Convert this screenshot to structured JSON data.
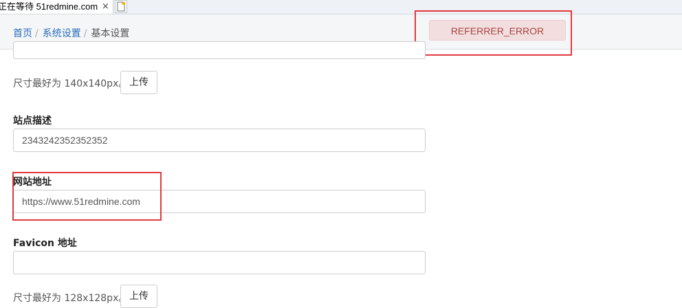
{
  "browser": {
    "tab_title": "正在等待 51redmine.com",
    "tab_close": "×"
  },
  "breadcrumb": {
    "home": "首页",
    "system": "系统设置",
    "current": "基本设置",
    "separator": "/"
  },
  "alert": {
    "message": "REFERRER_ERROR",
    "color": "#a94442",
    "background": "#f2dede"
  },
  "logo_upload": {
    "hint": "尺寸最好为 140x140px。",
    "button": "上传"
  },
  "site_description": {
    "label": "站点描述",
    "value": "2343242352352352"
  },
  "site_url": {
    "label": "网站地址",
    "value": "https://www.51redmine.com"
  },
  "favicon": {
    "label": "Favicon 地址",
    "value": "",
    "hint": "尺寸最好为 128x128px。",
    "button": "上传"
  },
  "highlight_color": "#e0393e",
  "icons": {
    "newtab": "new-tab-icon",
    "close": "close-icon"
  }
}
